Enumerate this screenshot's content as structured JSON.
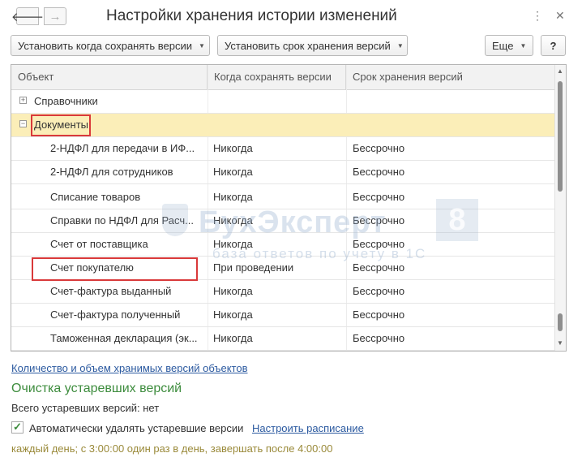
{
  "window": {
    "title": "Настройки хранения истории изменений",
    "back_glyph": "🡐",
    "forward_glyph": "→",
    "menu_glyph": "⋮",
    "close_glyph": "✕"
  },
  "toolbar": {
    "when_save_label": "Установить когда сохранять версии",
    "retention_label": "Установить срок хранения версий",
    "more_label": "Еще",
    "help_label": "?"
  },
  "grid": {
    "columns": [
      "Объект",
      "Когда сохранять версии",
      "Срок хранения версий"
    ],
    "groups": [
      {
        "label": "Справочники",
        "expander": "+"
      },
      {
        "label": "Документы",
        "expander": "−"
      }
    ],
    "rows": [
      {
        "object": "2-НДФЛ для передачи в ИФ...",
        "when": "Никогда",
        "retention": "Бессрочно"
      },
      {
        "object": "2-НДФЛ для сотрудников",
        "when": "Никогда",
        "retention": "Бессрочно"
      },
      {
        "object": "Списание товаров",
        "when": "Никогда",
        "retention": "Бессрочно"
      },
      {
        "object": "Справки по НДФЛ для Расч...",
        "when": "Никогда",
        "retention": "Бессрочно"
      },
      {
        "object": "Счет от поставщика",
        "when": "Никогда",
        "retention": "Бессрочно"
      },
      {
        "object": "Счет покупателю",
        "when": "При проведении",
        "retention": "Бессрочно"
      },
      {
        "object": "Счет-фактура выданный",
        "when": "Никогда",
        "retention": "Бессрочно"
      },
      {
        "object": "Счет-фактура полученный",
        "when": "Никогда",
        "retention": "Бессрочно"
      },
      {
        "object": "Таможенная декларация (эк...",
        "when": "Никогда",
        "retention": "Бессрочно"
      }
    ]
  },
  "watermark": {
    "brand": "БухЭксперт",
    "number": "8",
    "tagline": "база ответов по учету в 1С"
  },
  "footer": {
    "versions_link": "Количество и объем хранимых версий объектов",
    "cleanup_title": "Очистка устаревших версий",
    "obsolete_count": "Всего устаревших версий: нет",
    "auto_delete_label": "Автоматически удалять устаревшие версии",
    "auto_delete_checked": true,
    "schedule_link": "Настроить расписание",
    "schedule_text": "каждый день; с 3:00:00 один раз в день, завершать после 4:00:00"
  },
  "colors": {
    "selection": "#fbeeb8",
    "highlight_box": "#d9393a",
    "section_green": "#3d8c3d",
    "link_blue": "#2c5aa0"
  }
}
